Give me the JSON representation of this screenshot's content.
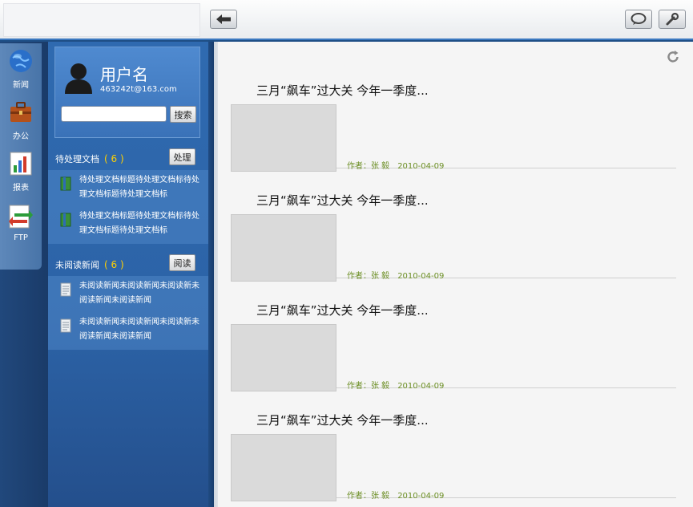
{
  "nav": {
    "items": [
      {
        "label": "新闻",
        "icon": "globe-icon"
      },
      {
        "label": "办公",
        "icon": "briefcase-icon"
      },
      {
        "label": "报表",
        "icon": "bar-chart-icon"
      },
      {
        "label": "FTP",
        "icon": "ftp-transfer-icon"
      }
    ]
  },
  "user": {
    "name": "用户名",
    "email": "463242t@163.com"
  },
  "search": {
    "placeholder": "",
    "button": "搜索"
  },
  "pending": {
    "title": "待处理文档",
    "count": "( 6 )",
    "button": "处理",
    "items": [
      "待处理文档标题待处理文档标待处理文档标题待处理文档标",
      "待处理文档标题待处理文档标待处理文档标题待处理文档标"
    ]
  },
  "unread": {
    "title": "未阅读新闻",
    "count": "( 6 )",
    "button": "阅读",
    "items": [
      "未阅读新闻未阅读新闻未阅读新未阅读新闻未阅读新闻",
      "未阅读新闻未阅读新闻未阅读新未阅读新闻未阅读新闻"
    ]
  },
  "news": [
    {
      "title": "三月“飙车”过大关 今年一季度...",
      "author": "作者：张 毅",
      "date": "2010-04-09"
    },
    {
      "title": "三月“飙车”过大关 今年一季度...",
      "author": "作者：张 毅",
      "date": "2010-04-09"
    },
    {
      "title": "三月“飙车”过大关 今年一季度...",
      "author": "作者：张 毅",
      "date": "2010-04-09"
    },
    {
      "title": "三月“飙车”过大关 今年一季度...",
      "author": "作者：张 毅",
      "date": "2010-04-09"
    }
  ],
  "colors": {
    "accent": "#3a78c0",
    "count": "#ffd000",
    "meta": "#6b8e23"
  }
}
